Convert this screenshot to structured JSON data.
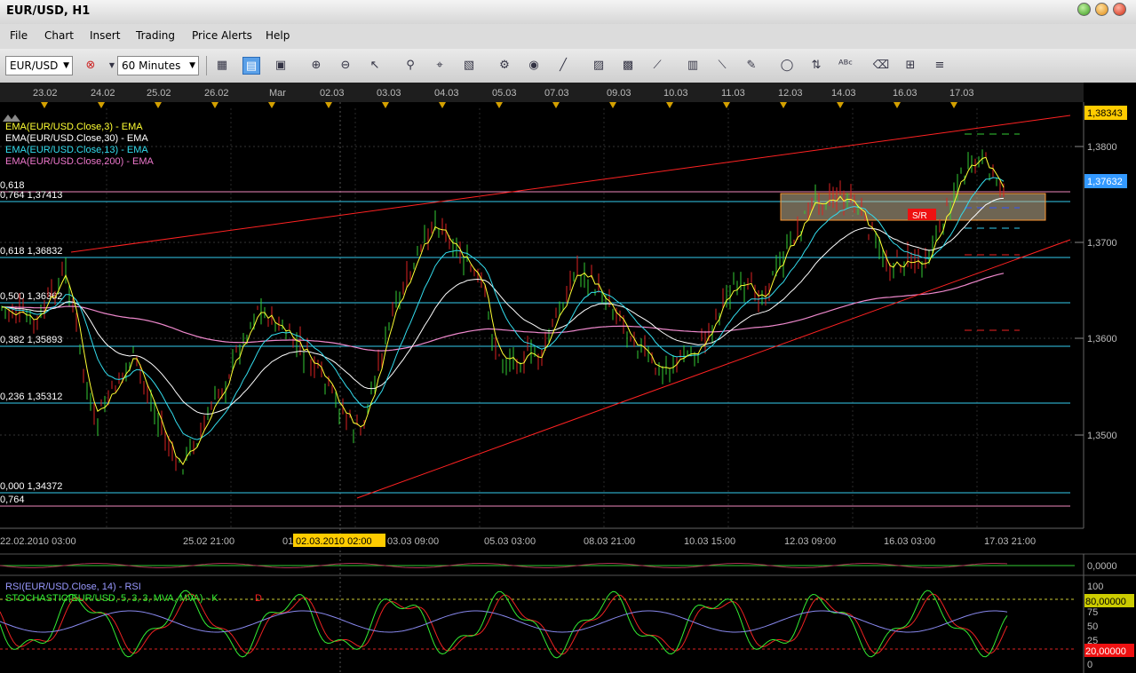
{
  "window": {
    "title": "EUR/USD, H1"
  },
  "menu": [
    "File",
    "Chart",
    "Insert",
    "Trading",
    "Price Alerts",
    "Help"
  ],
  "toolbar": {
    "symbol": "EUR/USD",
    "timeframe": "60 Minutes",
    "icons": [
      "chart-type-icon",
      "bar-chart-icon",
      "view-icon",
      "zoom-in-icon",
      "zoom-out-icon",
      "cursor-icon",
      "magnifier-icon",
      "crosshair-icon",
      "data-window-icon",
      "properties-icon",
      "globe-icon",
      "ruler-icon",
      "screenshot-icon",
      "template-icon",
      "line-tool-icon",
      "objects-icon",
      "trendline-icon",
      "pencil-icon",
      "ellipse-icon",
      "arrows-icon",
      "text-icon",
      "eraser-icon",
      "tree-icon",
      "more-icon"
    ]
  },
  "top_dates": [
    "23.02",
    "24.02",
    "25.02",
    "26.02",
    "Mar",
    "02.03",
    "03.03",
    "04.03",
    "05.03",
    "07.03",
    "09.03",
    "10.03",
    "11.03",
    "12.03",
    "14.03",
    "16.03",
    "17.03"
  ],
  "legend": [
    {
      "text": "EMA(EUR/USD.Close,3) - EMA",
      "color": "#ffff33"
    },
    {
      "text": "EMA(EUR/USD.Close,30) - EMA",
      "color": "#ffffff"
    },
    {
      "text": "EMA(EUR/USD.Close,13) - EMA",
      "color": "#33ddee"
    },
    {
      "text": "EMA(EUR/USD.Close,200) - EMA",
      "color": "#ee77cc"
    }
  ],
  "price_labels": [
    "1,3800",
    "1,3700",
    "1,3600",
    "1,3500"
  ],
  "price_tags": {
    "top": "1,38343",
    "current": "1,37632"
  },
  "sr_label": "S/R",
  "fib_labels": [
    "0,618",
    "0,764 1,37413",
    "0,618 1,36832",
    "0,500 1,36362",
    "0,382 1,35893",
    "0,236 1,35312",
    "0,000 1,34372",
    "0,764"
  ],
  "x_labels": [
    "22.02.2010 03:00",
    "25.02 21:00",
    "01",
    "03.03 09:00",
    "05.03 03:00",
    "08.03 21:00",
    "10.03 15:00",
    "12.03 09:00",
    "16.03 03:00",
    "17.03 21:00"
  ],
  "crosshair_label": "02.03.2010 02:00",
  "osc_value": "0,0000",
  "lower_legend": [
    {
      "text": "RSI(EUR/USD.Close, 14) - RSI",
      "color": "#9999ff"
    },
    {
      "text": "STOCHASTIC(EUR/USD, 5, 3, 3, MVA, MVA) - K",
      "color": "#33ee33"
    },
    {
      "text": "D",
      "color": "#ff2222"
    }
  ],
  "lower_scale": [
    "100",
    "50",
    "25",
    "0",
    "75"
  ],
  "lower_tags": {
    "upper": "80,00000",
    "lower": "20,00000"
  },
  "colors": {
    "background": "#000000",
    "grid": "#333333",
    "fib": "#33ccee",
    "channel": "#ff2222",
    "sr_zone": "#c8b898"
  }
}
